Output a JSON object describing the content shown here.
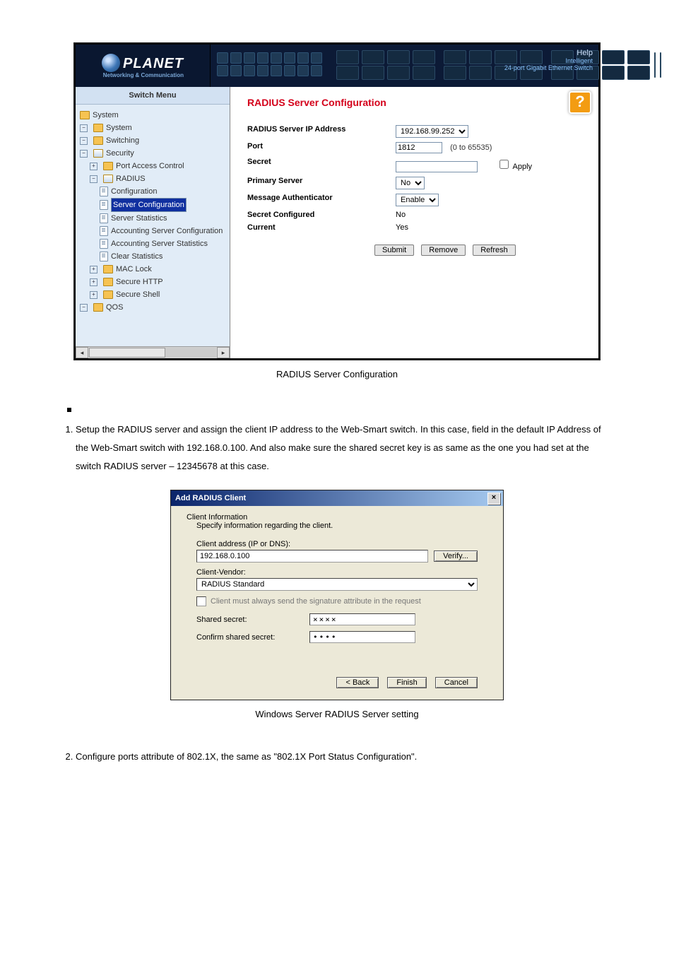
{
  "header": {
    "brand": "PLANET",
    "brand_subtitle": "Networking & Communication",
    "help_label": "Help",
    "device_line1": "Intelligent",
    "device_line2": "24-port Gigabit Ethernet Switch"
  },
  "sidebar": {
    "title": "Switch Menu",
    "items": [
      {
        "label": "System",
        "level": 0,
        "icon": "folder",
        "expand": ""
      },
      {
        "label": "System",
        "level": 0,
        "icon": "folder",
        "expand": "-"
      },
      {
        "label": "Switching",
        "level": 0,
        "icon": "folder",
        "expand": "-"
      },
      {
        "label": "Security",
        "level": 0,
        "icon": "folder-open",
        "expand": "-"
      },
      {
        "label": "Port Access Control",
        "level": 1,
        "icon": "folder",
        "expand": "+"
      },
      {
        "label": "RADIUS",
        "level": 1,
        "icon": "folder-open",
        "expand": "-"
      },
      {
        "label": "Configuration",
        "level": 2,
        "icon": "page"
      },
      {
        "label": "Server Configuration",
        "level": 2,
        "icon": "page",
        "selected": true
      },
      {
        "label": "Server Statistics",
        "level": 2,
        "icon": "page"
      },
      {
        "label": "Accounting Server Configuration",
        "level": 2,
        "icon": "page"
      },
      {
        "label": "Accounting Server Statistics",
        "level": 2,
        "icon": "page"
      },
      {
        "label": "Clear Statistics",
        "level": 2,
        "icon": "page"
      },
      {
        "label": "MAC Lock",
        "level": 1,
        "icon": "folder",
        "expand": "+"
      },
      {
        "label": "Secure HTTP",
        "level": 1,
        "icon": "folder",
        "expand": "+"
      },
      {
        "label": "Secure Shell",
        "level": 1,
        "icon": "folder",
        "expand": "+"
      },
      {
        "label": "QOS",
        "level": 0,
        "icon": "folder",
        "expand": "-"
      }
    ]
  },
  "form": {
    "title": "RADIUS Server Configuration",
    "rows": {
      "ip_label": "RADIUS Server IP Address",
      "ip_value": "192.168.99.252",
      "port_label": "Port",
      "port_value": "1812",
      "port_hint": "(0 to 65535)",
      "secret_label": "Secret",
      "secret_value": "",
      "apply_label": "Apply",
      "primary_label": "Primary Server",
      "primary_value": "No",
      "msgauth_label": "Message Authenticator",
      "msgauth_value": "Enable",
      "secretconf_label": "Secret Configured",
      "secretconf_value": "No",
      "current_label": "Current",
      "current_value": "Yes"
    },
    "buttons": {
      "submit": "Submit",
      "remove": "Remove",
      "refresh": "Refresh"
    }
  },
  "caption1": "RADIUS Server Configuration",
  "steps": {
    "step1": "Setup the RADIUS server and assign the client IP address to the Web-Smart switch. In this case, field in the default IP Address of the Web-Smart switch with 192.168.0.100. And also make sure the shared secret key is as same as the one you had set at the switch RADIUS server – 12345678 at this case.",
    "step2": "Configure ports attribute of 802.1X, the same as \"802.1X Port Status Configuration\"."
  },
  "dialog": {
    "title": "Add RADIUS Client",
    "section_head": "Client Information",
    "section_sub": "Specify information regarding the client.",
    "client_addr_label": "Client address (IP or DNS):",
    "client_addr_value": "192.168.0.100",
    "verify_btn": "Verify...",
    "vendor_label": "Client-Vendor:",
    "vendor_value": "RADIUS Standard",
    "checkbox_label": "Client must always send the signature attribute in the request",
    "shared_label": "Shared secret:",
    "shared_value": "××××",
    "confirm_label": "Confirm shared secret:",
    "confirm_value": "••••",
    "back_btn": "< Back",
    "finish_btn": "Finish",
    "cancel_btn": "Cancel"
  },
  "caption2": "Windows Server RADIUS Server setting"
}
